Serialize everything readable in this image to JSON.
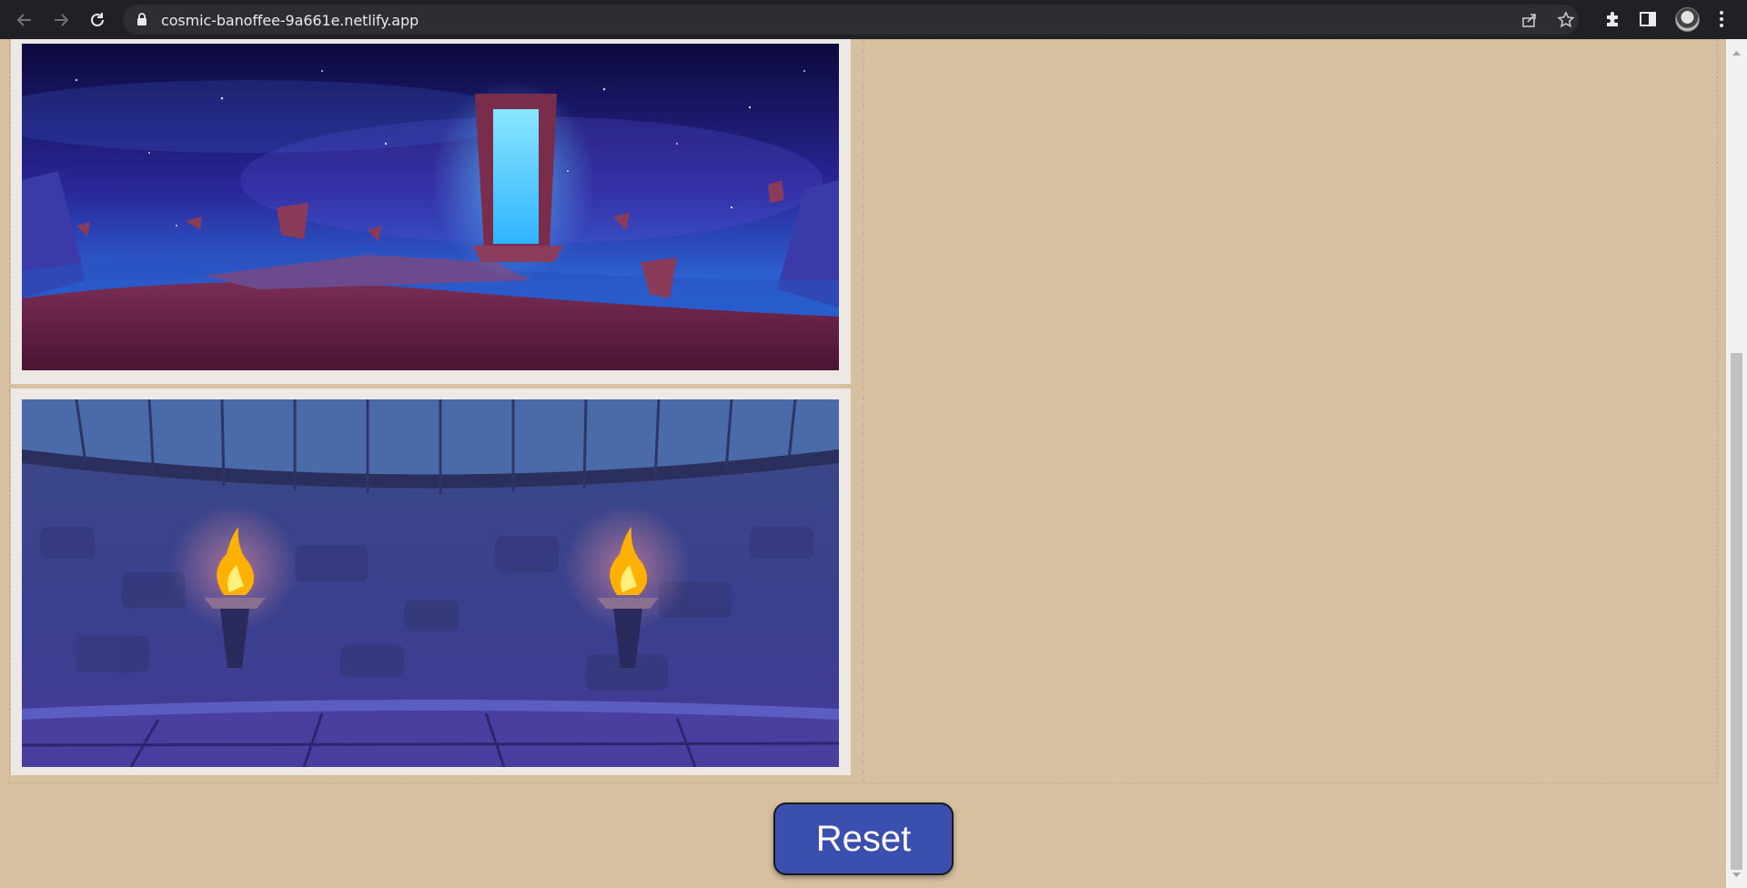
{
  "browser": {
    "url": "cosmic-banoffee-9a661e.netlify.app",
    "icons": [
      "back-arrow-icon",
      "forward-arrow-icon",
      "reload-icon",
      "lock-icon",
      "share-icon",
      "bookmark-star-icon",
      "extensions-puzzle-icon",
      "side-panel-icon",
      "profile-avatar",
      "menu-kebab-icon"
    ]
  },
  "gallery": {
    "images": [
      {
        "description_name": "floating-portal-scene"
      },
      {
        "description_name": "dungeon-torches-scene"
      }
    ]
  },
  "actions": {
    "reset_label": "Reset"
  },
  "colors": {
    "page_background": "#d7c0a0",
    "card_background": "#ede8e4",
    "reset_button": "#3b4fae"
  }
}
